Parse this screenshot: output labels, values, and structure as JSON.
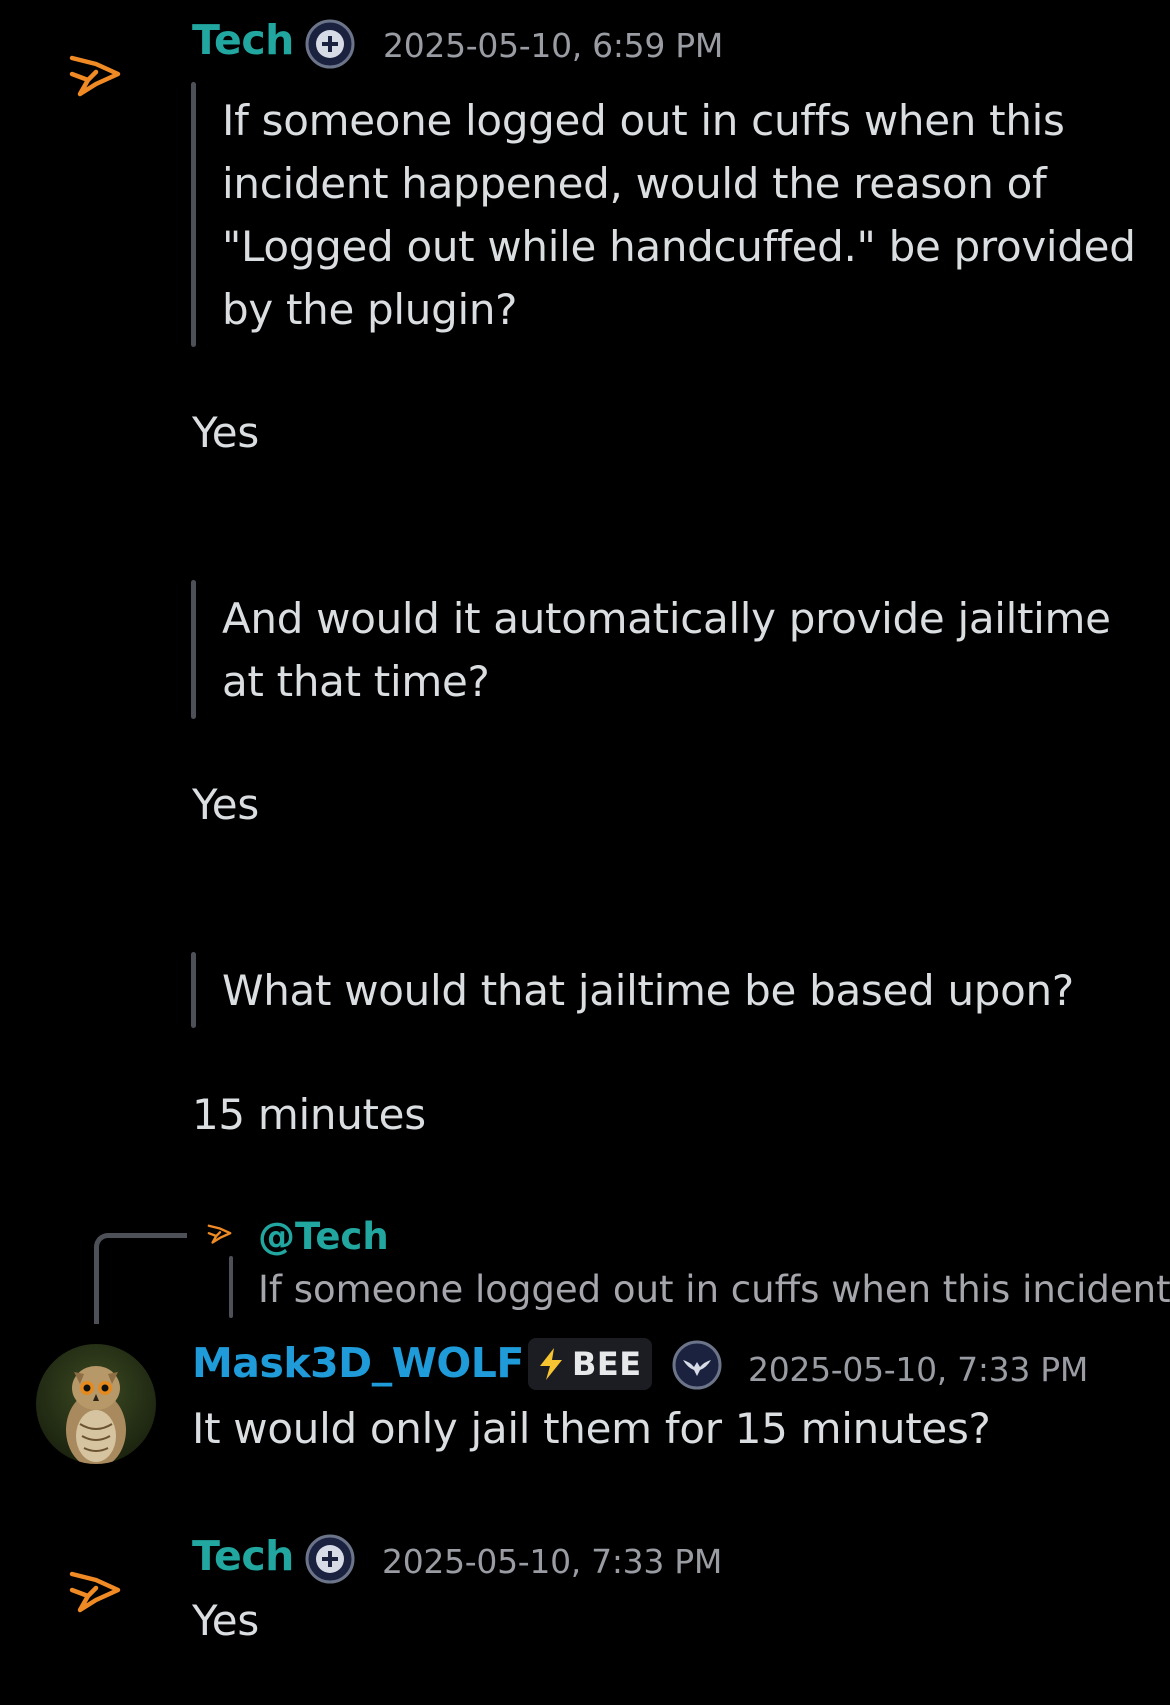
{
  "colors": {
    "background": "#000000",
    "tech_username": "#21a6a0",
    "wolf_username": "#1e9bd8",
    "fox_icon": "#f08a24",
    "quote_bar": "#4e5058",
    "timestamp": "#9a9ca3"
  },
  "messages": [
    {
      "author": "Tech",
      "avatar_icon": "fox-logo-icon",
      "role_icon": "plus-shield-icon",
      "timestamp": "2025-05-10, 6:59 PM",
      "quote1": [
        "If someone logged out in cuffs when this",
        "incident happened, would the reason of",
        "\"Logged out while handcuffed.\" be provided",
        "by the plugin?"
      ],
      "answer1": "Yes",
      "quote2": [
        "And would it automatically provide jailtime",
        "at that time?"
      ],
      "answer2": "Yes",
      "quote3": [
        "What would that jailtime be based upon?"
      ],
      "answer3": "15 minutes"
    },
    {
      "reply_to": {
        "mention": "@Tech",
        "preview": "If someone logged out in cuffs when this incident",
        "icon": "fox-logo-icon"
      },
      "author": "Mask3D_WOLF",
      "avatar_icon": "owl-avatar",
      "tag_icon": "lightning-icon",
      "tag_label": "BEE",
      "role_icon": "eagle-emblem-icon",
      "timestamp": "2025-05-10, 7:33 PM",
      "text": "It would only jail them for 15 minutes?"
    },
    {
      "author": "Tech",
      "avatar_icon": "fox-logo-icon",
      "role_icon": "plus-shield-icon",
      "timestamp": "2025-05-10, 7:33 PM",
      "text": "Yes"
    }
  ]
}
